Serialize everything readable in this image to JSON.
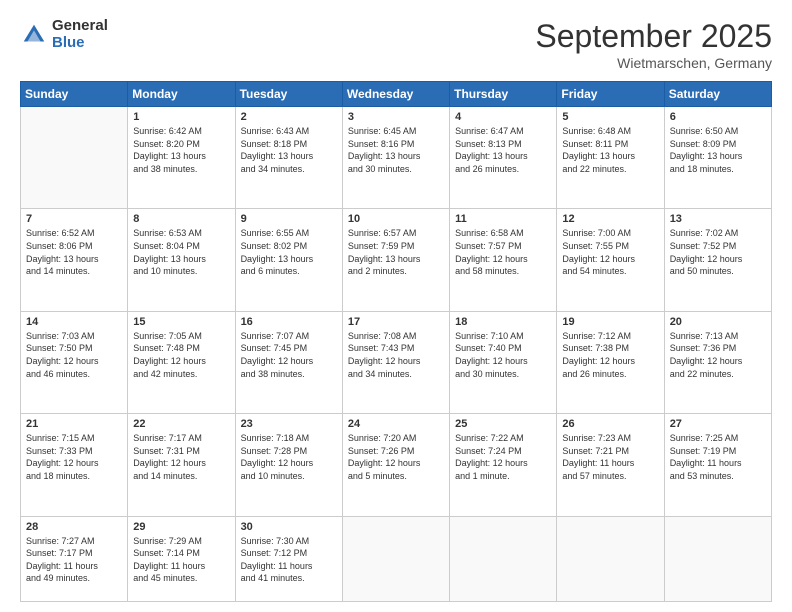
{
  "logo": {
    "general": "General",
    "blue": "Blue"
  },
  "header": {
    "month": "September 2025",
    "location": "Wietmarschen, Germany"
  },
  "weekdays": [
    "Sunday",
    "Monday",
    "Tuesday",
    "Wednesday",
    "Thursday",
    "Friday",
    "Saturday"
  ],
  "weeks": [
    [
      {
        "day": "",
        "info": ""
      },
      {
        "day": "1",
        "info": "Sunrise: 6:42 AM\nSunset: 8:20 PM\nDaylight: 13 hours\nand 38 minutes."
      },
      {
        "day": "2",
        "info": "Sunrise: 6:43 AM\nSunset: 8:18 PM\nDaylight: 13 hours\nand 34 minutes."
      },
      {
        "day": "3",
        "info": "Sunrise: 6:45 AM\nSunset: 8:16 PM\nDaylight: 13 hours\nand 30 minutes."
      },
      {
        "day": "4",
        "info": "Sunrise: 6:47 AM\nSunset: 8:13 PM\nDaylight: 13 hours\nand 26 minutes."
      },
      {
        "day": "5",
        "info": "Sunrise: 6:48 AM\nSunset: 8:11 PM\nDaylight: 13 hours\nand 22 minutes."
      },
      {
        "day": "6",
        "info": "Sunrise: 6:50 AM\nSunset: 8:09 PM\nDaylight: 13 hours\nand 18 minutes."
      }
    ],
    [
      {
        "day": "7",
        "info": "Sunrise: 6:52 AM\nSunset: 8:06 PM\nDaylight: 13 hours\nand 14 minutes."
      },
      {
        "day": "8",
        "info": "Sunrise: 6:53 AM\nSunset: 8:04 PM\nDaylight: 13 hours\nand 10 minutes."
      },
      {
        "day": "9",
        "info": "Sunrise: 6:55 AM\nSunset: 8:02 PM\nDaylight: 13 hours\nand 6 minutes."
      },
      {
        "day": "10",
        "info": "Sunrise: 6:57 AM\nSunset: 7:59 PM\nDaylight: 13 hours\nand 2 minutes."
      },
      {
        "day": "11",
        "info": "Sunrise: 6:58 AM\nSunset: 7:57 PM\nDaylight: 12 hours\nand 58 minutes."
      },
      {
        "day": "12",
        "info": "Sunrise: 7:00 AM\nSunset: 7:55 PM\nDaylight: 12 hours\nand 54 minutes."
      },
      {
        "day": "13",
        "info": "Sunrise: 7:02 AM\nSunset: 7:52 PM\nDaylight: 12 hours\nand 50 minutes."
      }
    ],
    [
      {
        "day": "14",
        "info": "Sunrise: 7:03 AM\nSunset: 7:50 PM\nDaylight: 12 hours\nand 46 minutes."
      },
      {
        "day": "15",
        "info": "Sunrise: 7:05 AM\nSunset: 7:48 PM\nDaylight: 12 hours\nand 42 minutes."
      },
      {
        "day": "16",
        "info": "Sunrise: 7:07 AM\nSunset: 7:45 PM\nDaylight: 12 hours\nand 38 minutes."
      },
      {
        "day": "17",
        "info": "Sunrise: 7:08 AM\nSunset: 7:43 PM\nDaylight: 12 hours\nand 34 minutes."
      },
      {
        "day": "18",
        "info": "Sunrise: 7:10 AM\nSunset: 7:40 PM\nDaylight: 12 hours\nand 30 minutes."
      },
      {
        "day": "19",
        "info": "Sunrise: 7:12 AM\nSunset: 7:38 PM\nDaylight: 12 hours\nand 26 minutes."
      },
      {
        "day": "20",
        "info": "Sunrise: 7:13 AM\nSunset: 7:36 PM\nDaylight: 12 hours\nand 22 minutes."
      }
    ],
    [
      {
        "day": "21",
        "info": "Sunrise: 7:15 AM\nSunset: 7:33 PM\nDaylight: 12 hours\nand 18 minutes."
      },
      {
        "day": "22",
        "info": "Sunrise: 7:17 AM\nSunset: 7:31 PM\nDaylight: 12 hours\nand 14 minutes."
      },
      {
        "day": "23",
        "info": "Sunrise: 7:18 AM\nSunset: 7:28 PM\nDaylight: 12 hours\nand 10 minutes."
      },
      {
        "day": "24",
        "info": "Sunrise: 7:20 AM\nSunset: 7:26 PM\nDaylight: 12 hours\nand 5 minutes."
      },
      {
        "day": "25",
        "info": "Sunrise: 7:22 AM\nSunset: 7:24 PM\nDaylight: 12 hours\nand 1 minute."
      },
      {
        "day": "26",
        "info": "Sunrise: 7:23 AM\nSunset: 7:21 PM\nDaylight: 11 hours\nand 57 minutes."
      },
      {
        "day": "27",
        "info": "Sunrise: 7:25 AM\nSunset: 7:19 PM\nDaylight: 11 hours\nand 53 minutes."
      }
    ],
    [
      {
        "day": "28",
        "info": "Sunrise: 7:27 AM\nSunset: 7:17 PM\nDaylight: 11 hours\nand 49 minutes."
      },
      {
        "day": "29",
        "info": "Sunrise: 7:29 AM\nSunset: 7:14 PM\nDaylight: 11 hours\nand 45 minutes."
      },
      {
        "day": "30",
        "info": "Sunrise: 7:30 AM\nSunset: 7:12 PM\nDaylight: 11 hours\nand 41 minutes."
      },
      {
        "day": "",
        "info": ""
      },
      {
        "day": "",
        "info": ""
      },
      {
        "day": "",
        "info": ""
      },
      {
        "day": "",
        "info": ""
      }
    ]
  ]
}
